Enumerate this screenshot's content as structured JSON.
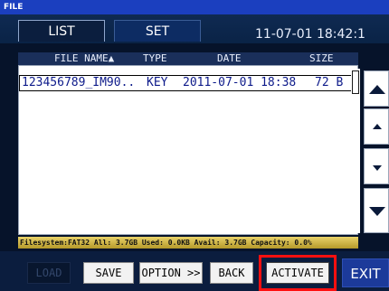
{
  "window": {
    "title": "FILE"
  },
  "tabs": [
    {
      "label": "LIST"
    },
    {
      "label": "SET"
    }
  ],
  "clock": "11-07-01 18:42:1",
  "table": {
    "columns": [
      "FILE NAME▲",
      "TYPE",
      "DATE",
      "SIZE"
    ],
    "rows": [
      {
        "name": "123456789_IM90..",
        "type": "KEY",
        "date": "2011-07-01 18:38",
        "size": "72 B"
      }
    ]
  },
  "status": "Filesystem:FAT32  All: 3.7GB  Used: 0.0KB  Avail: 3.7GB  Capacity: 0.0%",
  "buttons": {
    "load": "LOAD",
    "save": "SAVE",
    "option": "OPTION >>",
    "back": "BACK",
    "activate": "ACTIVATE",
    "exit": "EXIT"
  },
  "colors": {
    "accent": "#1b3fbf",
    "highlight": "#ff1010",
    "list_text": "#0d1a8a"
  },
  "icons": {
    "scroll_top": "triangle-up-large-icon",
    "scroll_up": "triangle-up-small-icon",
    "scroll_down": "triangle-down-small-icon",
    "scroll_bottom": "triangle-down-large-icon"
  }
}
